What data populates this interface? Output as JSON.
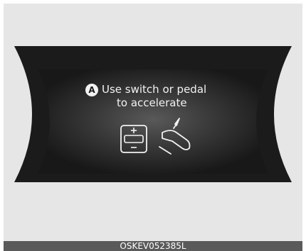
{
  "display": {
    "badge_letter": "A",
    "message_line1": "Use switch or pedal",
    "message_line2": "to accelerate"
  },
  "icons": {
    "switch": "accelerate-switch-icon",
    "pedal": "accelerator-pedal-icon"
  },
  "caption": {
    "code": "OSKEV052385L"
  },
  "colors": {
    "panel_background": "#e6e6e6",
    "display_dark": "#1b1b1b",
    "display_text": "#f2f2f2",
    "caption_bar": "#5a5a5a"
  }
}
